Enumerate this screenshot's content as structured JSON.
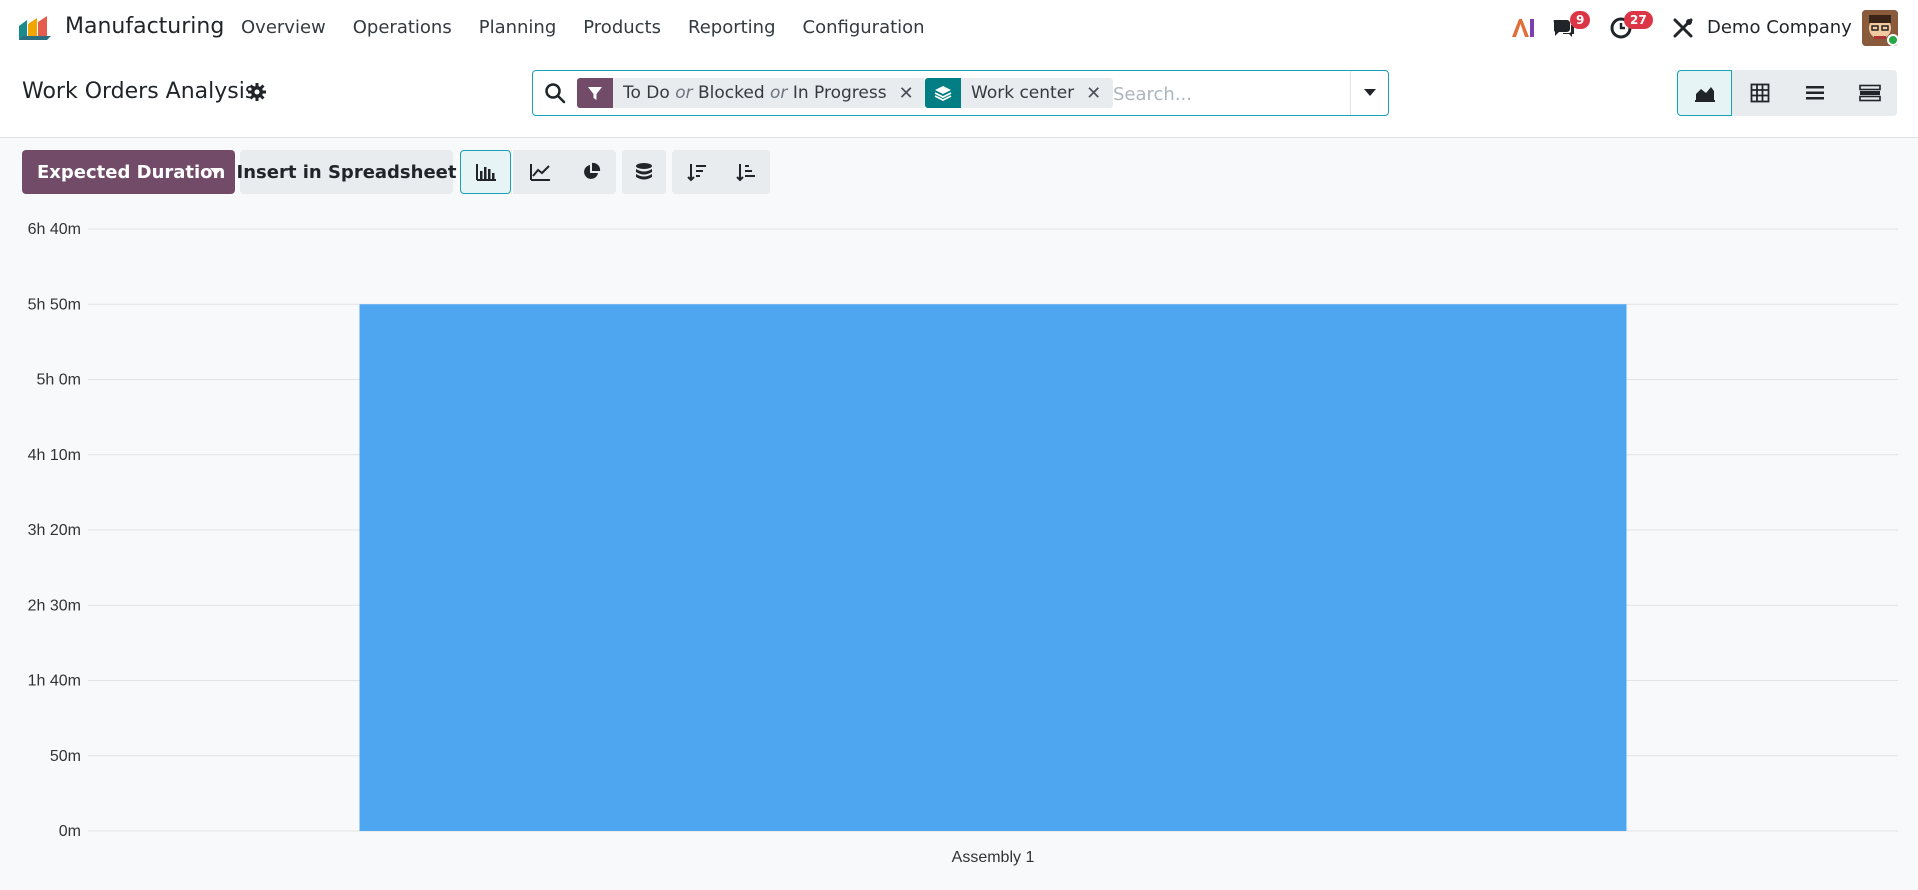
{
  "app": {
    "name": "Manufacturing",
    "menu": [
      "Overview",
      "Operations",
      "Planning",
      "Products",
      "Reporting",
      "Configuration"
    ]
  },
  "systray": {
    "messages_count": "9",
    "activities_count": "27",
    "company": "Demo Company"
  },
  "page": {
    "title": "Work Orders Analysis"
  },
  "search": {
    "facets": [
      {
        "type": "filter",
        "parts": [
          "To Do",
          "or",
          "Blocked",
          "or",
          "In Progress"
        ]
      },
      {
        "type": "groupby",
        "parts": [
          "Work center"
        ]
      }
    ],
    "placeholder": "Search..."
  },
  "toolbar": {
    "measure_label": "Expected Duration",
    "spreadsheet_label": "Insert in Spreadsheet"
  },
  "colors": {
    "brand": "#714b67",
    "accent": "#17a2b8",
    "bar": "#4ea6f0",
    "badge": "#dc3545"
  },
  "chart_data": {
    "type": "bar",
    "categories": [
      "Assembly 1"
    ],
    "series": [
      {
        "values": [
          350
        ]
      }
    ],
    "value_unit": "minutes",
    "y_ticks": [
      "0m",
      "50m",
      "1h 40m",
      "2h 30m",
      "3h 20m",
      "4h 10m",
      "5h 0m",
      "5h 50m",
      "6h 40m"
    ],
    "ylim": [
      0,
      400
    ],
    "grid": true
  }
}
